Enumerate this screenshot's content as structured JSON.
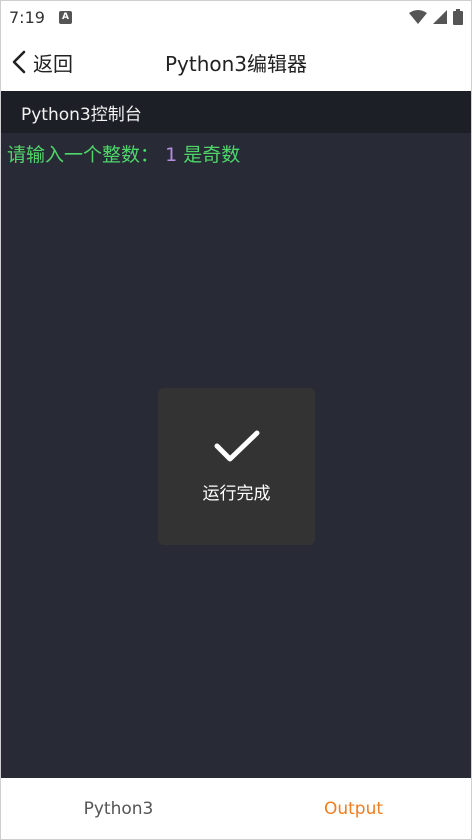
{
  "status_bar": {
    "time": "7:19",
    "notification_glyph": "A"
  },
  "header": {
    "back_label": "返回",
    "title": "Python3编辑器"
  },
  "console": {
    "title": "Python3控制台",
    "output": {
      "prompt": "请输入一个整数：",
      "input": "1",
      "result": "是奇数"
    }
  },
  "toast": {
    "icon": "checkmark-icon",
    "label": "运行完成"
  },
  "tabs": [
    {
      "label": "Python3",
      "active": false
    },
    {
      "label": "Output",
      "active": true
    }
  ],
  "colors": {
    "console_bg": "#282b36",
    "console_bar_bg": "#1d1f27",
    "output_green": "#4ed66a",
    "output_purple": "#b48ddc",
    "active_tab": "#f07d1f"
  }
}
